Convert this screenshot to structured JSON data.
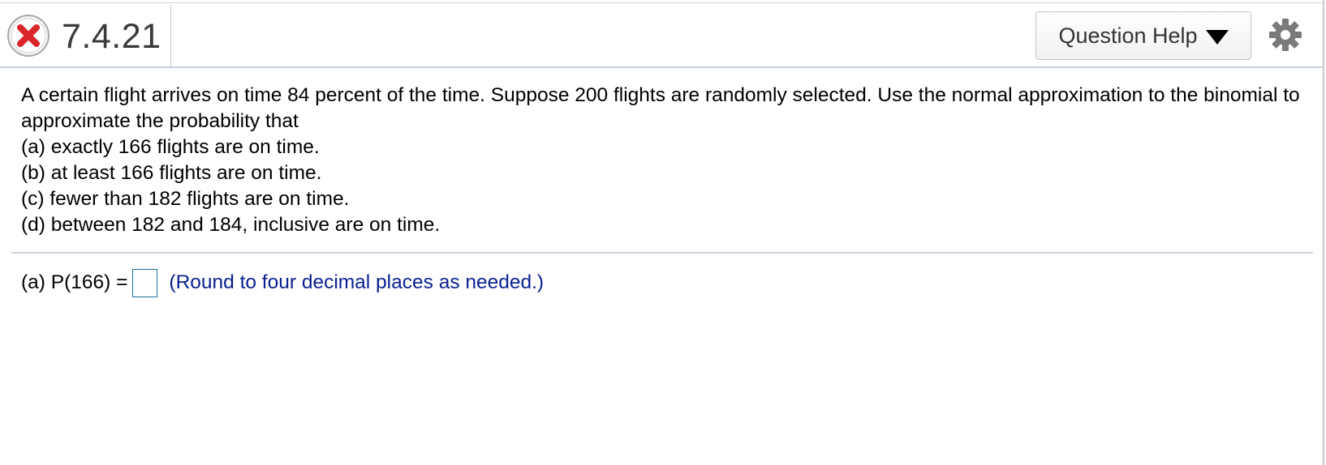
{
  "header": {
    "status_icon": "x-circle-icon",
    "question_number": "7.4.21",
    "help_button_label": "Question Help",
    "help_dropdown_icon": "caret-down-icon",
    "settings_icon": "gear-icon"
  },
  "question": {
    "intro": "A certain flight arrives on time 84 percent of the time. Suppose 200 flights are randomly selected. Use the normal approximation to the binomial to approximate the probability that",
    "parts": [
      "(a) exactly 166 flights are on time.",
      "(b) at least 166 flights are on time.",
      "(c) fewer than 182 flights are on time.",
      "(d) between 182 and 184, inclusive are on time."
    ]
  },
  "answer": {
    "label": "(a) P(166) =",
    "value": "",
    "hint": "(Round to four decimal places as needed.)"
  },
  "colors": {
    "status_red": "#d9262b",
    "hint_blue": "#0a1f8f",
    "input_border": "#1b6f9c"
  }
}
